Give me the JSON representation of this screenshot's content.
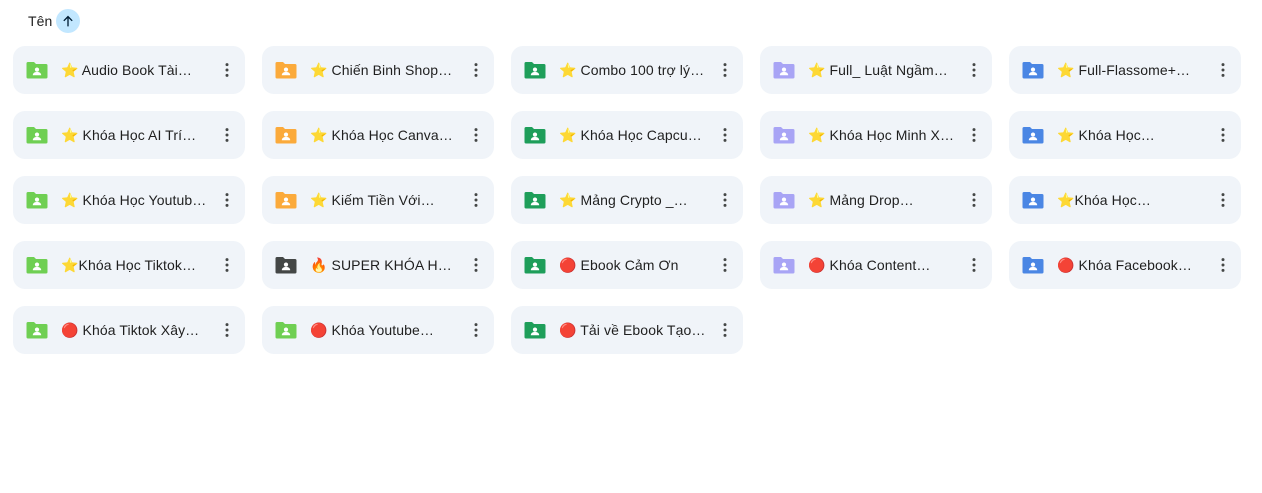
{
  "header": {
    "sort_label": "Tên",
    "sort_icon": "arrow-up-icon",
    "sort_color": "#c2e7ff"
  },
  "colors": {
    "lightgreen": "#6fcf53",
    "orange": "#fbaa3b",
    "green": "#1e9e5a",
    "lavender": "#a8a4f5",
    "blue": "#4a86e4",
    "dark": "#444746"
  },
  "folders": [
    {
      "title": "⭐ Audio Book Tài…",
      "color": "lightgreen",
      "icon": "shared-folder-icon"
    },
    {
      "title": "⭐ Chiến Binh Shop…",
      "color": "orange",
      "icon": "shared-folder-icon"
    },
    {
      "title": "⭐ Combo 100 trợ lý…",
      "color": "green",
      "icon": "shared-folder-icon"
    },
    {
      "title": "⭐ Full_ Luật Ngầm…",
      "color": "lavender",
      "icon": "shared-folder-icon"
    },
    {
      "title": "⭐ Full-Flassome+…",
      "color": "blue",
      "icon": "shared-folder-icon"
    },
    {
      "title": "⭐ Khóa Học AI Trí…",
      "color": "lightgreen",
      "icon": "shared-folder-icon"
    },
    {
      "title": "⭐ Khóa Học Canva…",
      "color": "orange",
      "icon": "shared-folder-icon"
    },
    {
      "title": "⭐ Khóa Học Capcu…",
      "color": "green",
      "icon": "shared-folder-icon"
    },
    {
      "title": "⭐ Khóa Học Minh X…",
      "color": "lavender",
      "icon": "shared-folder-icon"
    },
    {
      "title": "⭐ Khóa Học…",
      "color": "blue",
      "icon": "shared-folder-icon"
    },
    {
      "title": "⭐ Khóa Học Youtub…",
      "color": "lightgreen",
      "icon": "shared-folder-icon"
    },
    {
      "title": "⭐ Kiếm Tiền Với…",
      "color": "orange",
      "icon": "shared-folder-icon"
    },
    {
      "title": "⭐ Mảng Crypto _…",
      "color": "green",
      "icon": "shared-folder-icon"
    },
    {
      "title": "⭐ Mảng Drop…",
      "color": "lavender",
      "icon": "shared-folder-icon"
    },
    {
      "title": "⭐Khóa Học…",
      "color": "blue",
      "icon": "shared-folder-icon"
    },
    {
      "title": "⭐Khóa Học Tiktok…",
      "color": "lightgreen",
      "icon": "shared-folder-icon"
    },
    {
      "title": "🔥 SUPER KHÓA HỌ…",
      "color": "dark",
      "icon": "shared-folder-icon"
    },
    {
      "title": "🔴 Ebook Cảm Ơn",
      "color": "green",
      "icon": "shared-folder-icon"
    },
    {
      "title": "🔴 Khóa Content…",
      "color": "lavender",
      "icon": "shared-folder-icon"
    },
    {
      "title": "🔴 Khóa Facebook…",
      "color": "blue",
      "icon": "shared-folder-icon"
    },
    {
      "title": "🔴 Khóa Tiktok Xây…",
      "color": "lightgreen",
      "icon": "shared-folder-icon"
    },
    {
      "title": "🔴 Khóa Youtube…",
      "color": "lightgreen",
      "icon": "shared-folder-icon"
    },
    {
      "title": "🔴 Tải về Ebook Tạo…",
      "color": "green",
      "icon": "shared-folder-icon"
    }
  ],
  "more_icon": "more-vert-icon"
}
